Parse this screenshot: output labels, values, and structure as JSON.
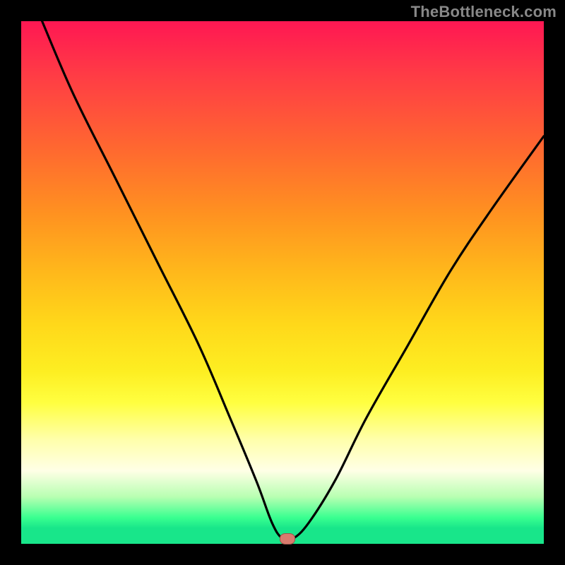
{
  "watermark": "TheBottleneck.com",
  "chart_data": {
    "type": "line",
    "title": "",
    "xlabel": "",
    "ylabel": "",
    "xlim": [
      0,
      100
    ],
    "ylim": [
      0,
      100
    ],
    "grid": false,
    "series": [
      {
        "name": "bottleneck-curve",
        "x": [
          4,
          10,
          18,
          26,
          34,
          40,
          45,
          48,
          50,
          52,
          55,
          60,
          66,
          74,
          82,
          90,
          100
        ],
        "values": [
          100,
          86,
          70,
          54,
          38,
          24,
          12,
          4,
          1,
          1,
          4,
          12,
          24,
          38,
          52,
          64,
          78
        ]
      }
    ],
    "annotations": [
      {
        "name": "optimal-point",
        "x": 51,
        "y": 1
      }
    ],
    "background_gradient": {
      "stops": [
        {
          "pos": 0,
          "color": "#ff1753"
        },
        {
          "pos": 11,
          "color": "#ff3e44"
        },
        {
          "pos": 25,
          "color": "#ff6a2f"
        },
        {
          "pos": 37,
          "color": "#ff9220"
        },
        {
          "pos": 48,
          "color": "#ffb81b"
        },
        {
          "pos": 58,
          "color": "#ffd81a"
        },
        {
          "pos": 67,
          "color": "#fdee22"
        },
        {
          "pos": 73,
          "color": "#ffff40"
        },
        {
          "pos": 80,
          "color": "#ffffaa"
        },
        {
          "pos": 86,
          "color": "#ffffe6"
        },
        {
          "pos": 91,
          "color": "#b8ffb2"
        },
        {
          "pos": 95,
          "color": "#39ff90"
        },
        {
          "pos": 100,
          "color": "#18e68a"
        }
      ]
    },
    "marker_color": "#d97b6e"
  }
}
